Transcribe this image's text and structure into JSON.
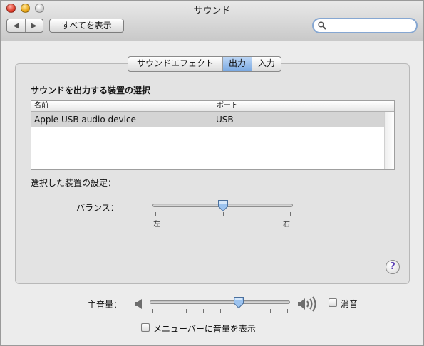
{
  "window": {
    "title": "サウンド"
  },
  "toolbar": {
    "back_glyph": "◀",
    "forward_glyph": "▶",
    "show_all_label": "すべてを表示",
    "search_value": "",
    "search_icon": "magnifier-icon"
  },
  "tabs": [
    {
      "label": "サウンドエフェクト",
      "active": false
    },
    {
      "label": "出力",
      "active": true
    },
    {
      "label": "入力",
      "active": false
    }
  ],
  "output": {
    "section_title": "サウンドを出力する装置の選択",
    "table": {
      "columns": [
        "名前",
        "ポート"
      ],
      "rows": [
        {
          "name": "Apple USB audio device",
          "port": "USB",
          "selected": true
        }
      ]
    },
    "settings_label": "選択した装置の設定：",
    "balance": {
      "label": "バランス：",
      "left_label": "左",
      "right_label": "右",
      "value": 0.5
    }
  },
  "help_glyph": "?",
  "volume": {
    "label": "主音量：",
    "value": 0.64,
    "mute_label": "消音",
    "mute_checked": false
  },
  "menubar_option": {
    "label": "メニューバーに音量を表示",
    "checked": false
  },
  "colors": {
    "selected_tab": "#7aa9e2",
    "selected_row": "#d4d4d4",
    "search_ring": "#86a7d2",
    "help_accent": "#5b3fb5"
  }
}
